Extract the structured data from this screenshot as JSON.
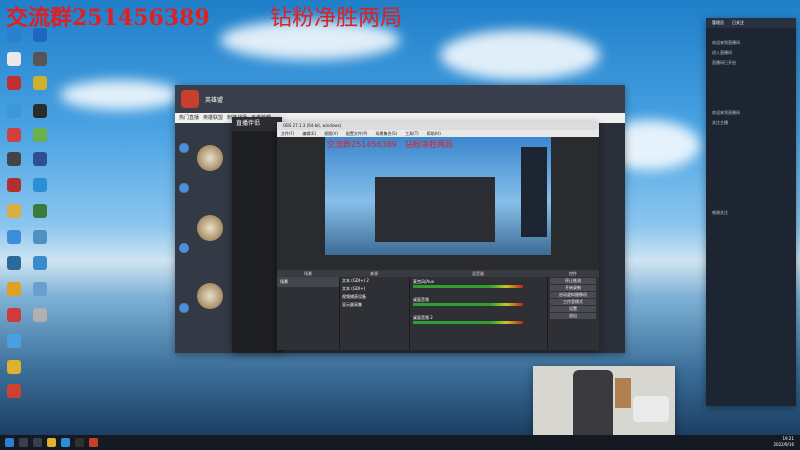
{
  "overlay": {
    "group_text": "交流群251456389",
    "promo_text": "钻粉净胜两局"
  },
  "colors": {
    "overlay_red": "#e02020",
    "taskbar": "#151a22"
  },
  "chat_window": {
    "title": "英雄盟",
    "tabs": [
      "热门直播",
      "英雄联盟",
      "刺激战场",
      "王者荣耀"
    ]
  },
  "zs_window": {
    "title": "直播伴侣"
  },
  "obs": {
    "title": "OBS 27.1.3 (64-bit, windows)",
    "menu": [
      "文件(F)",
      "编辑(E)",
      "视图(V)",
      "配置文件(P)",
      "场景集合(S)",
      "工具(T)",
      "帮助(H)"
    ],
    "preview_overlay_left": "交流群251456389",
    "preview_overlay_right": "钻粉净胜两局",
    "docks": {
      "scenes": "场景",
      "sources": "来源",
      "mixer": "混音器",
      "controls": "控件"
    },
    "scene_item": "场景",
    "sources": [
      "文本 (GDI+) 2",
      "文本 (GDI+)",
      "视频捕获设备",
      "显示器采集"
    ],
    "controls": [
      "停止推流",
      "开始录制",
      "启动虚拟摄像机",
      "工作室模式",
      "设置",
      "退出"
    ],
    "mixer_tracks": [
      "麦克风/Aux",
      "桌面音频",
      "桌面音频 2"
    ]
  },
  "notification": {
    "header": [
      "管理员",
      "已关注"
    ],
    "lines": [
      "欢迎来到直播间",
      "进入直播间",
      "直播间已开启",
      "欢迎来到直播间",
      "关注主播",
      "感谢关注"
    ]
  },
  "taskbar": {
    "time": "19:21",
    "date": "2022/9/16"
  }
}
